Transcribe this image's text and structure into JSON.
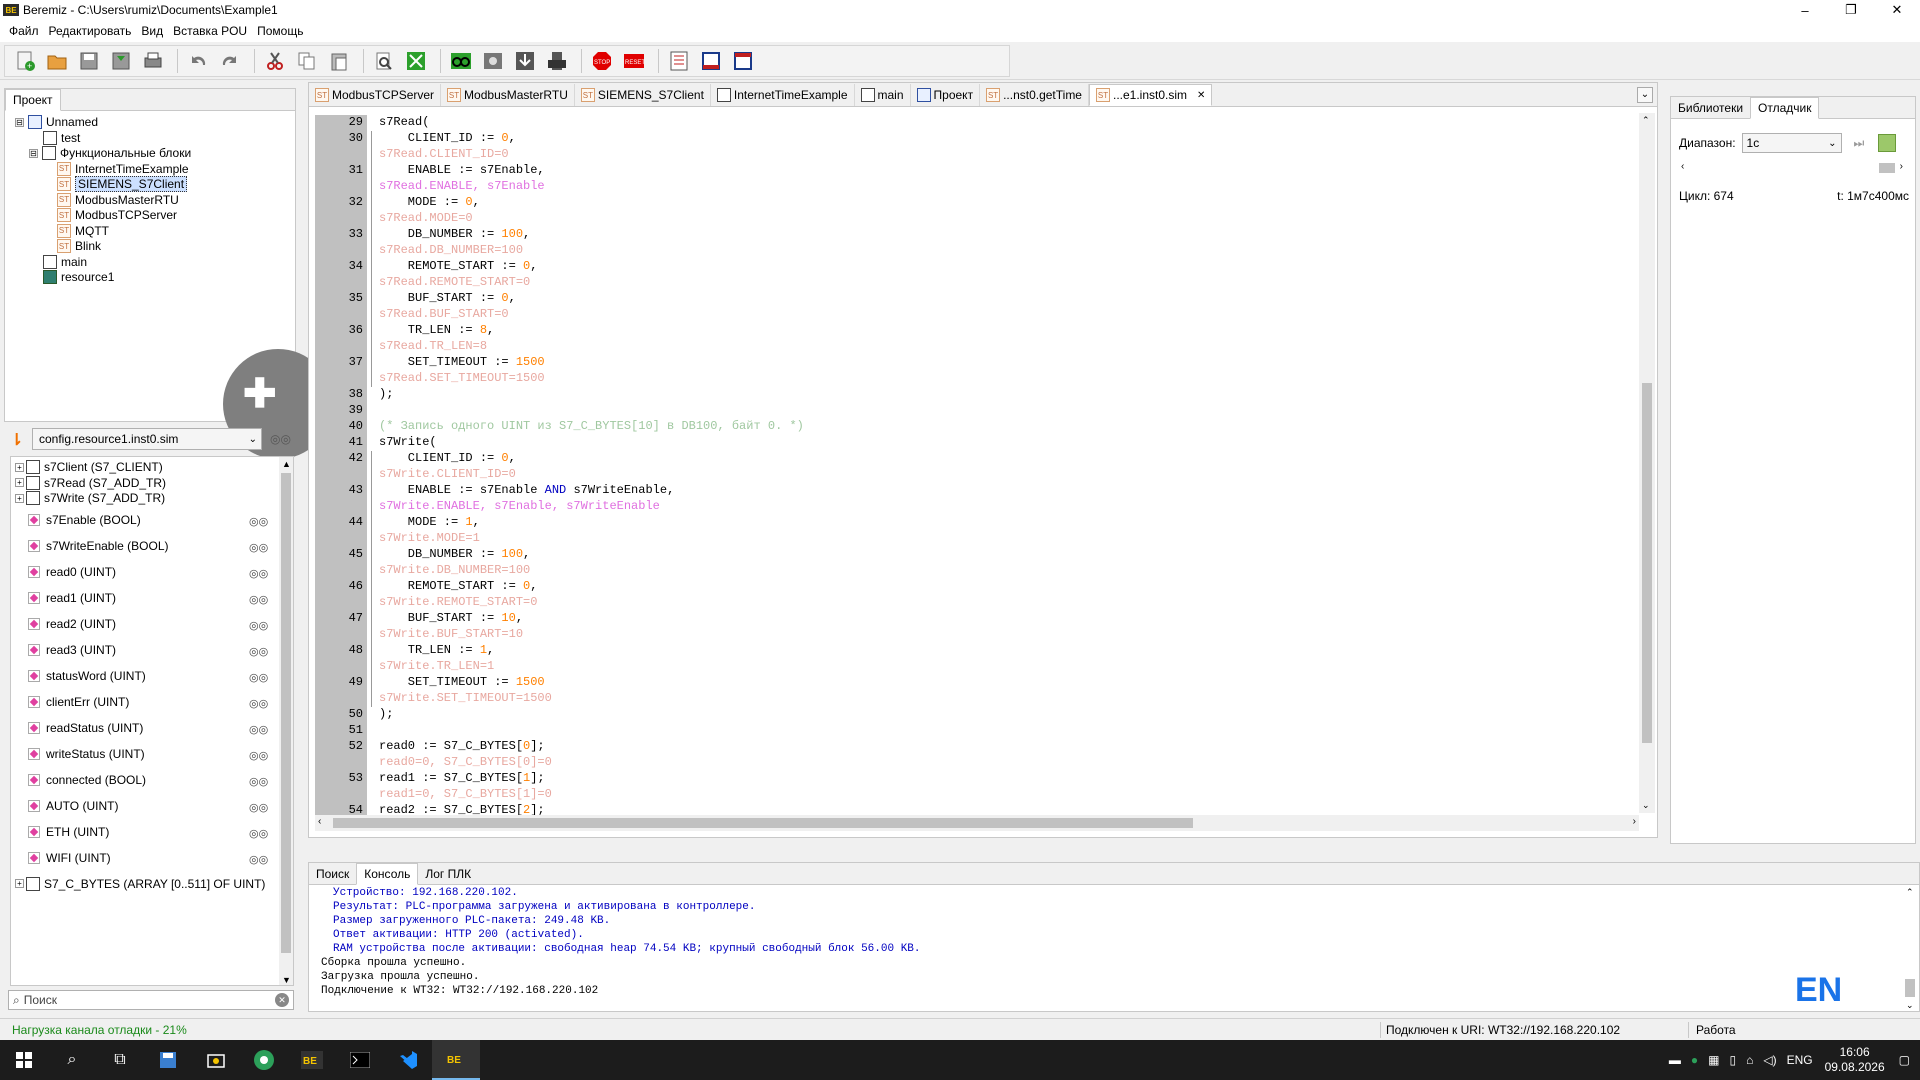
{
  "window": {
    "app_logo": "BE",
    "title": "Beremiz - C:\\Users\\rumiz\\Documents\\Example1",
    "controls": [
      "–",
      "❐",
      "✕"
    ]
  },
  "menu": [
    "Файл",
    "Редактировать",
    "Вид",
    "Вставка POU",
    "Помощь"
  ],
  "project_panel": {
    "tab": "Проект",
    "tree": [
      {
        "label": "Unnamed",
        "icon": "project-icon",
        "level": 0,
        "expander": "⊟"
      },
      {
        "label": "test",
        "icon": "fb-icon",
        "level": 1
      },
      {
        "label": "Функциональные блоки",
        "icon": "fb-icon",
        "level": 1,
        "expander": "⊟"
      },
      {
        "label": "InternetTimeExample",
        "icon": "st-icon",
        "level": 2
      },
      {
        "label": "SIEMENS_S7Client",
        "icon": "st-icon",
        "level": 2,
        "selected": true
      },
      {
        "label": "ModbusMasterRTU",
        "icon": "st-icon",
        "level": 2
      },
      {
        "label": "ModbusTCPServer",
        "icon": "st-icon",
        "level": 2
      },
      {
        "label": "MQTT",
        "icon": "st-icon",
        "level": 2
      },
      {
        "label": "Blink",
        "icon": "st-icon",
        "level": 2
      },
      {
        "label": "main",
        "icon": "program-icon",
        "level": 1
      },
      {
        "label": "resource1",
        "icon": "resource-icon",
        "level": 1
      }
    ]
  },
  "instance_selector": {
    "value": "config.resource1.inst0.sim"
  },
  "variables": {
    "groups": [
      "s7Client (S7_CLIENT)",
      "s7Read (S7_ADD_TR)",
      "s7Write (S7_ADD_TR)"
    ],
    "items": [
      "s7Enable (BOOL)",
      "s7WriteEnable (BOOL)",
      "read0 (UINT)",
      "read1 (UINT)",
      "read2 (UINT)",
      "read3 (UINT)",
      "statusWord (UINT)",
      "clientErr (UINT)",
      "readStatus (UINT)",
      "writeStatus (UINT)",
      "connected (BOOL)",
      "AUTO (UINT)",
      "ETH (UINT)",
      "WIFI (UINT)"
    ],
    "last_group": "S7_C_BYTES (ARRAY [0..511] OF UINT)",
    "search_placeholder": "Поиск"
  },
  "editor": {
    "tabs": [
      {
        "label": "ModbusTCPServer",
        "icon": "st"
      },
      {
        "label": "ModbusMasterRTU",
        "icon": "st"
      },
      {
        "label": "SIEMENS_S7Client",
        "icon": "st"
      },
      {
        "label": "InternetTimeExample",
        "icon": "fb"
      },
      {
        "label": "main",
        "icon": "program"
      },
      {
        "label": "Проект",
        "icon": "project"
      },
      {
        "label": "...nst0.getTime",
        "icon": "st"
      },
      {
        "label": "...e1.inst0.sim",
        "icon": "st",
        "active": true,
        "closable": "✕"
      }
    ],
    "lines": [
      {
        "n": "29",
        "t": "s7Read(",
        "k": "code"
      },
      {
        "n": "30",
        "t": "    CLIENT_ID := 0,",
        "k": "code"
      },
      {
        "n": "",
        "t": "s7Read.CLIENT_ID=0",
        "k": "dbg"
      },
      {
        "n": "31",
        "t": "    ENABLE := s7Enable,",
        "k": "code"
      },
      {
        "n": "",
        "t": "s7Read.ENABLE, s7Enable",
        "k": "dbgm"
      },
      {
        "n": "32",
        "t": "    MODE := 0,",
        "k": "code"
      },
      {
        "n": "",
        "t": "s7Read.MODE=0",
        "k": "dbg"
      },
      {
        "n": "33",
        "t": "    DB_NUMBER := 100,",
        "k": "code"
      },
      {
        "n": "",
        "t": "s7Read.DB_NUMBER=100",
        "k": "dbg"
      },
      {
        "n": "34",
        "t": "    REMOTE_START := 0,",
        "k": "code"
      },
      {
        "n": "",
        "t": "s7Read.REMOTE_START=0",
        "k": "dbg"
      },
      {
        "n": "35",
        "t": "    BUF_START := 0,",
        "k": "code"
      },
      {
        "n": "",
        "t": "s7Read.BUF_START=0",
        "k": "dbg"
      },
      {
        "n": "36",
        "t": "    TR_LEN := 8,",
        "k": "code"
      },
      {
        "n": "",
        "t": "s7Read.TR_LEN=8",
        "k": "dbg"
      },
      {
        "n": "37",
        "t": "    SET_TIMEOUT := 1500",
        "k": "code"
      },
      {
        "n": "",
        "t": "s7Read.SET_TIMEOUT=1500",
        "k": "dbg"
      },
      {
        "n": "38",
        "t": ");",
        "k": "code"
      },
      {
        "n": "39",
        "t": "",
        "k": "code"
      },
      {
        "n": "40",
        "t": "(* Запись одного UINT из S7_C_BYTES[10] в DB100, байт 0. *)",
        "k": "cmt"
      },
      {
        "n": "41",
        "t": "s7Write(",
        "k": "code"
      },
      {
        "n": "42",
        "t": "    CLIENT_ID := 0,",
        "k": "code"
      },
      {
        "n": "",
        "t": "s7Write.CLIENT_ID=0",
        "k": "dbg"
      },
      {
        "n": "43",
        "t": "    ENABLE := s7Enable AND s7WriteEnable,",
        "k": "code"
      },
      {
        "n": "",
        "t": "s7Write.ENABLE, s7Enable, s7WriteEnable",
        "k": "dbgm"
      },
      {
        "n": "44",
        "t": "    MODE := 1,",
        "k": "code"
      },
      {
        "n": "",
        "t": "s7Write.MODE=1",
        "k": "dbg"
      },
      {
        "n": "45",
        "t": "    DB_NUMBER := 100,",
        "k": "code"
      },
      {
        "n": "",
        "t": "s7Write.DB_NUMBER=100",
        "k": "dbg"
      },
      {
        "n": "46",
        "t": "    REMOTE_START := 0,",
        "k": "code"
      },
      {
        "n": "",
        "t": "s7Write.REMOTE_START=0",
        "k": "dbg"
      },
      {
        "n": "47",
        "t": "    BUF_START := 10,",
        "k": "code"
      },
      {
        "n": "",
        "t": "s7Write.BUF_START=10",
        "k": "dbg"
      },
      {
        "n": "48",
        "t": "    TR_LEN := 1,",
        "k": "code"
      },
      {
        "n": "",
        "t": "s7Write.TR_LEN=1",
        "k": "dbg"
      },
      {
        "n": "49",
        "t": "    SET_TIMEOUT := 1500",
        "k": "code"
      },
      {
        "n": "",
        "t": "s7Write.SET_TIMEOUT=1500",
        "k": "dbg"
      },
      {
        "n": "50",
        "t": ");",
        "k": "code"
      },
      {
        "n": "51",
        "t": "",
        "k": "code"
      },
      {
        "n": "52",
        "t": "read0 := S7_C_BYTES[0];",
        "k": "code"
      },
      {
        "n": "",
        "t": "read0=0, S7_C_BYTES[0]=0",
        "k": "dbg"
      },
      {
        "n": "53",
        "t": "read1 := S7_C_BYTES[1];",
        "k": "code"
      },
      {
        "n": "",
        "t": "read1=0, S7_C_BYTES[1]=0",
        "k": "dbg"
      },
      {
        "n": "54",
        "t": "read2 := S7_C_BYTES[2];",
        "k": "code"
      }
    ]
  },
  "right_panel": {
    "tabs": [
      "Библиотеки",
      "Отладчик"
    ],
    "active_tab": "Отладчик",
    "range_label": "Диапазон:",
    "range_value": "1с",
    "cycle": "Цикл: 674",
    "time": "t: 1м7с400мс"
  },
  "bottom_panel": {
    "tabs": [
      "Поиск",
      "Консоль",
      "Лог ПЛК"
    ],
    "active_tab": "Консоль",
    "lines": [
      {
        "t": "Устройство: 192.168.220.102.",
        "blue": true
      },
      {
        "t": "Результат: PLC-программа загружена и активирована в контроллере.",
        "blue": true
      },
      {
        "t": "Размер загруженного PLC-пакета: 249.48 KB.",
        "blue": true
      },
      {
        "t": "Ответ активации: HTTP 200 (activated).",
        "blue": true
      },
      {
        "t": "RAM устройства после активации: свободная heap 74.54 KB; крупный свободный блок 56.00 KB.",
        "blue": true
      },
      {
        "t": "Сборка прошла успешно.",
        "blue": false
      },
      {
        "t": "Загрузка прошла успешно.",
        "blue": false
      },
      {
        "t": "Подключение к WT32: WT32://192.168.220.102",
        "blue": false
      }
    ],
    "lang_badge": "EN"
  },
  "status": {
    "left": "Нагрузка канала отладки - 21%",
    "uri": "Подключен к URI: WT32://192.168.220.102",
    "state": "Работа"
  },
  "taskbar": {
    "lang": "ENG",
    "time": "16:06",
    "date": "09.08.2026"
  },
  "colors": {
    "status_green": "#1a8a1a",
    "debug_value": "#e8a8a0",
    "debug_magenta": "#e070e0",
    "comment": "#a0c8a0",
    "number": "#ff8000",
    "keyword": "#0000c0",
    "console_blue": "#0000c0",
    "accent": "#1a73e8"
  }
}
